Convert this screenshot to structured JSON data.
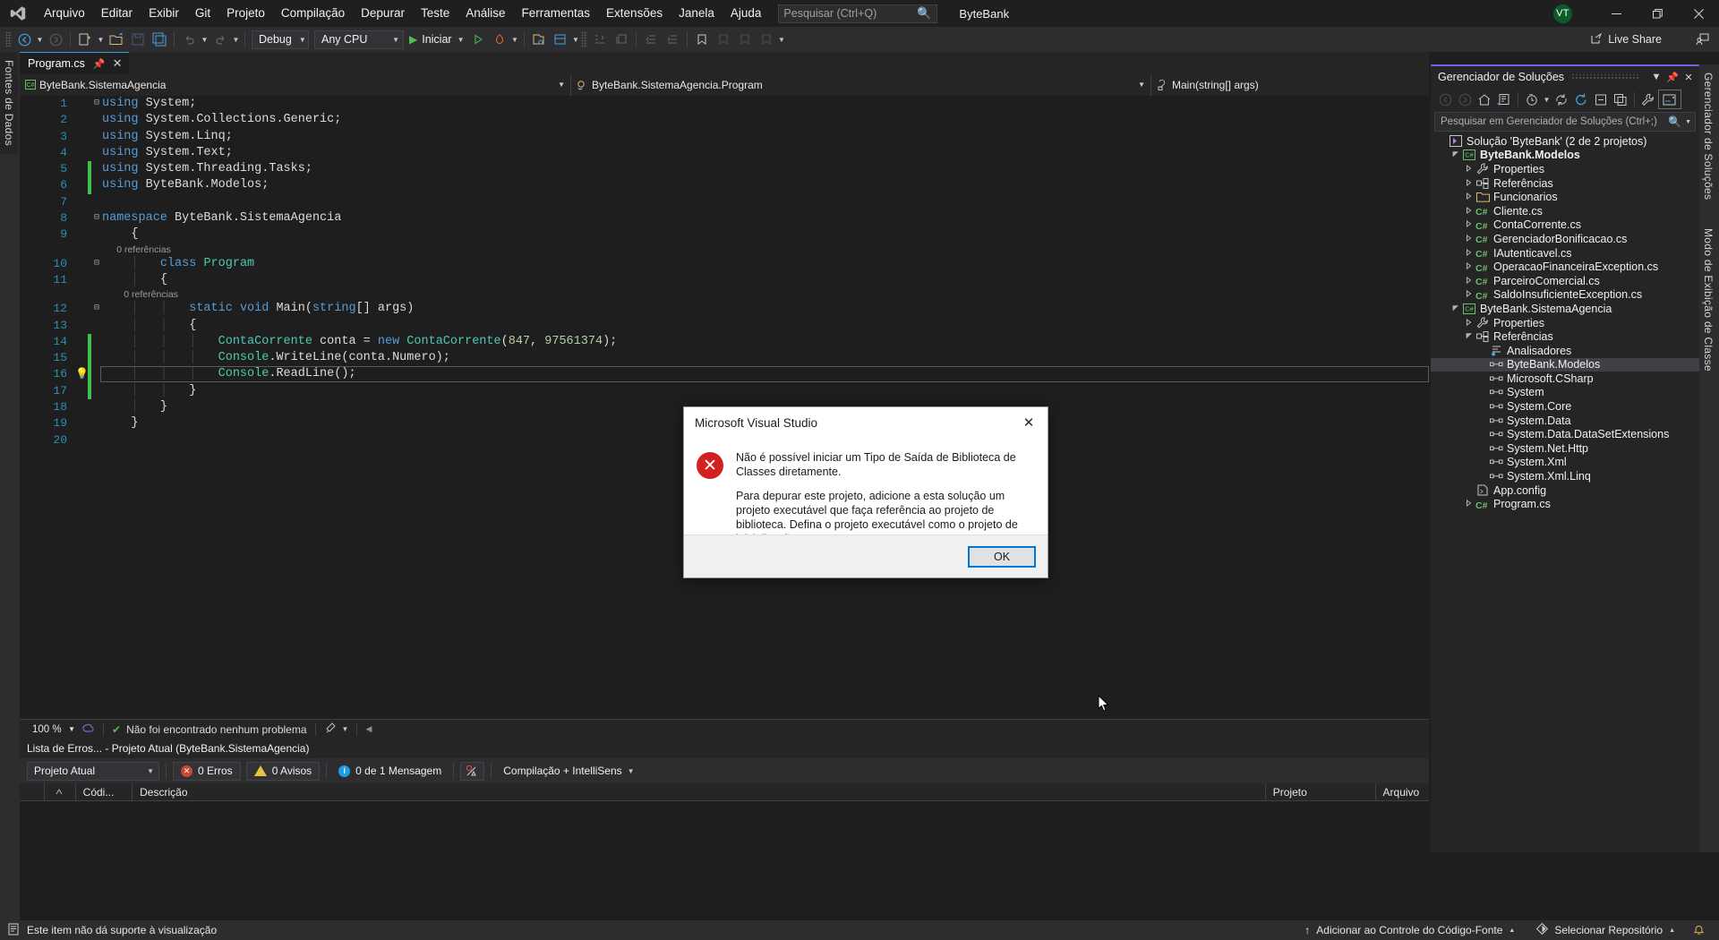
{
  "titlebar": {
    "logo_icon": "visual-studio-logo-icon",
    "menu": [
      "Arquivo",
      "Editar",
      "Exibir",
      "Git",
      "Projeto",
      "Compilação",
      "Depurar",
      "Teste",
      "Análise",
      "Ferramentas",
      "Extensões",
      "Janela",
      "Ajuda"
    ],
    "search_placeholder": "Pesquisar (Ctrl+Q)",
    "search_value": "",
    "search_icon": "search-icon",
    "solution_name": "ByteBank",
    "avatar_initials": "VT",
    "minimize_icon": "minimize-icon",
    "restore_icon": "restore-icon",
    "close_icon": "close-icon"
  },
  "toolbar": {
    "nav_back_icon": "navigate-back-icon",
    "nav_forward_icon": "navigate-forward-icon",
    "new_project_icon": "new-project-icon",
    "open_icon": "open-folder-icon",
    "save_icon": "save-icon",
    "save_all_icon": "save-all-icon",
    "undo_icon": "undo-icon",
    "redo_icon": "redo-icon",
    "config_value": "Debug",
    "platform_value": "Any CPU",
    "start_label": "Iniciar",
    "start_icon": "play-triangle-icon",
    "start_no_debug_icon": "play-outline-icon",
    "hotreload_icon": "hot-reload-icon",
    "preview_icon": "preview-changes-icon",
    "live_share_label": "Live Share",
    "live_share_icon": "live-share-icon",
    "live_share_user_icon": "live-share-user-icon"
  },
  "left_dock": {
    "tab_label": "Fontes de Dados"
  },
  "right_dock": {
    "tabs": [
      "Gerenciador de Soluções",
      "Modo de Exibição de Classe"
    ]
  },
  "editor": {
    "tab_label": "Program.cs",
    "tab_pin_icon": "pin-icon",
    "tab_close_icon": "close-icon",
    "nav_project": "ByteBank.SistemaAgencia",
    "nav_project_icon": "csharp-project-icon",
    "nav_type": "ByteBank.SistemaAgencia.Program",
    "nav_type_icon": "class-icon",
    "nav_member": "Main(string[] args)",
    "nav_member_icon": "method-icon",
    "current_line": 16,
    "lines": [
      {
        "n": 1,
        "fold": "minus",
        "change": "",
        "ref": null,
        "tokens": [
          {
            "t": "using",
            "c": "kw"
          },
          {
            "t": " System;",
            "c": ""
          }
        ],
        "indent": 0
      },
      {
        "n": 2,
        "fold": "",
        "change": "",
        "ref": null,
        "tokens": [
          {
            "t": "using",
            "c": "kw"
          },
          {
            "t": " System.Collections.Generic;",
            "c": ""
          }
        ],
        "indent": 0
      },
      {
        "n": 3,
        "fold": "",
        "change": "",
        "ref": null,
        "tokens": [
          {
            "t": "using",
            "c": "kw"
          },
          {
            "t": " System.Linq;",
            "c": ""
          }
        ],
        "indent": 0
      },
      {
        "n": 4,
        "fold": "",
        "change": "",
        "ref": null,
        "tokens": [
          {
            "t": "using",
            "c": "kw"
          },
          {
            "t": " System.Text;",
            "c": ""
          }
        ],
        "indent": 0
      },
      {
        "n": 5,
        "fold": "",
        "change": "green",
        "ref": null,
        "tokens": [
          {
            "t": "using",
            "c": "kw"
          },
          {
            "t": " System.Threading.Tasks;",
            "c": ""
          }
        ],
        "indent": 0
      },
      {
        "n": 6,
        "fold": "",
        "change": "green",
        "ref": null,
        "tokens": [
          {
            "t": "using",
            "c": "kw"
          },
          {
            "t": " ByteBank.Modelos;",
            "c": ""
          }
        ],
        "indent": 0
      },
      {
        "n": 7,
        "fold": "",
        "change": "",
        "ref": null,
        "tokens": [],
        "indent": 0
      },
      {
        "n": 8,
        "fold": "minus",
        "change": "",
        "ref": null,
        "tokens": [
          {
            "t": "namespace",
            "c": "kw"
          },
          {
            "t": " ByteBank.SistemaAgencia",
            "c": ""
          }
        ],
        "indent": 0
      },
      {
        "n": 9,
        "fold": "",
        "change": "",
        "ref": null,
        "tokens": [
          {
            "t": "{",
            "c": ""
          }
        ],
        "indent": 1
      },
      {
        "n": 10,
        "fold": "minus",
        "change": "",
        "ref": "0 referências",
        "tokens": [
          {
            "t": "class",
            "c": "kw"
          },
          {
            "t": " ",
            "c": ""
          },
          {
            "t": "Program",
            "c": "typ"
          }
        ],
        "indent": 2
      },
      {
        "n": 11,
        "fold": "",
        "change": "",
        "ref": null,
        "tokens": [
          {
            "t": "{",
            "c": ""
          }
        ],
        "indent": 2
      },
      {
        "n": 12,
        "fold": "minus",
        "change": "",
        "ref": "0 referências",
        "tokens": [
          {
            "t": "static",
            "c": "kw"
          },
          {
            "t": " ",
            "c": ""
          },
          {
            "t": "void",
            "c": "kw"
          },
          {
            "t": " Main(",
            "c": ""
          },
          {
            "t": "string",
            "c": "kw"
          },
          {
            "t": "[] args)",
            "c": ""
          }
        ],
        "indent": 3
      },
      {
        "n": 13,
        "fold": "",
        "change": "",
        "ref": null,
        "tokens": [
          {
            "t": "{",
            "c": ""
          }
        ],
        "indent": 3
      },
      {
        "n": 14,
        "fold": "",
        "change": "green",
        "ref": null,
        "tokens": [
          {
            "t": "ContaCorrente",
            "c": "typ"
          },
          {
            "t": " conta = ",
            "c": ""
          },
          {
            "t": "new",
            "c": "kw"
          },
          {
            "t": " ",
            "c": ""
          },
          {
            "t": "ContaCorrente",
            "c": "typ"
          },
          {
            "t": "(",
            "c": ""
          },
          {
            "t": "847",
            "c": "num"
          },
          {
            "t": ", ",
            "c": ""
          },
          {
            "t": "97561374",
            "c": "num"
          },
          {
            "t": ");",
            "c": ""
          }
        ],
        "indent": 4
      },
      {
        "n": 15,
        "fold": "",
        "change": "green",
        "ref": null,
        "tokens": [
          {
            "t": "Console",
            "c": "typ"
          },
          {
            "t": ".WriteLine(conta.Numero);",
            "c": ""
          }
        ],
        "indent": 4
      },
      {
        "n": 16,
        "fold": "",
        "change": "green",
        "ref": null,
        "glyph": "lightbulb",
        "tokens": [
          {
            "t": "Console",
            "c": "typ"
          },
          {
            "t": ".ReadLine();",
            "c": ""
          }
        ],
        "indent": 4
      },
      {
        "n": 17,
        "fold": "",
        "change": "green",
        "ref": null,
        "tokens": [
          {
            "t": "}",
            "c": ""
          }
        ],
        "indent": 3
      },
      {
        "n": 18,
        "fold": "",
        "change": "",
        "ref": null,
        "tokens": [
          {
            "t": "}",
            "c": ""
          }
        ],
        "indent": 2
      },
      {
        "n": 19,
        "fold": "",
        "change": "",
        "ref": null,
        "tokens": [
          {
            "t": "}",
            "c": ""
          }
        ],
        "indent": 1
      },
      {
        "n": 20,
        "fold": "",
        "change": "",
        "ref": null,
        "tokens": [],
        "indent": 0
      }
    ]
  },
  "editor_status": {
    "zoom": "100 %",
    "zoom_caret_icon": "chevron-down-icon",
    "intellicode_icon": "intellicode-icon",
    "health_text": "Não foi encontrado nenhum problema",
    "health_icon": "check-circle-icon",
    "broom_icon": "code-cleanup-icon",
    "collapse_icon": "collapse-left-icon"
  },
  "error_list": {
    "title": "Lista de Erros... - Projeto Atual (ByteBank.SistemaAgencia)",
    "scope_value": "Projeto Atual",
    "errors_label": "0 Erros",
    "warnings_label": "0 Avisos",
    "messages_label": "0 de 1 Mensagem",
    "filter_icon": "error-filter-icon",
    "build_filter": "Compilação + IntelliSens",
    "columns": [
      "",
      "Códi...",
      "Descrição",
      "Projeto",
      "Arquivo"
    ]
  },
  "solution_explorer": {
    "title": "Gerenciador de Soluções",
    "dropdown_icon": "chevron-down-icon",
    "pin_icon": "pin-icon",
    "close_icon": "close-icon",
    "toolbar_icons": [
      "back-icon",
      "forward-icon",
      "home-icon",
      "solution-views-icon",
      "pending-changes-icon",
      "refresh-icon",
      "sync-icon",
      "collapse-all-icon",
      "show-all-files-icon",
      "properties-wrench-icon",
      "preview-selected-icon"
    ],
    "search_placeholder": "Pesquisar em Gerenciador de Soluções (Ctrl+;)",
    "search_icon": "search-icon",
    "search_caret_icon": "chevron-down-icon",
    "tree": [
      {
        "label": "Solução 'ByteBank' (2 de 2 projetos)",
        "indent": 0,
        "exp": "",
        "icon": "solution-icon",
        "bold": false,
        "sel": false
      },
      {
        "label": "ByteBank.Modelos",
        "indent": 1,
        "exp": "open",
        "icon": "csharp-project-icon",
        "bold": true,
        "sel": false
      },
      {
        "label": "Properties",
        "indent": 2,
        "exp": "closed",
        "icon": "wrench-icon",
        "bold": false,
        "sel": false
      },
      {
        "label": "Referências",
        "indent": 2,
        "exp": "closed",
        "icon": "references-icon",
        "bold": false,
        "sel": false
      },
      {
        "label": "Funcionarios",
        "indent": 2,
        "exp": "closed",
        "icon": "folder-icon",
        "bold": false,
        "sel": false
      },
      {
        "label": "Cliente.cs",
        "indent": 2,
        "exp": "closed",
        "icon": "csharp-file-icon",
        "bold": false,
        "sel": false
      },
      {
        "label": "ContaCorrente.cs",
        "indent": 2,
        "exp": "closed",
        "icon": "csharp-file-icon",
        "bold": false,
        "sel": false
      },
      {
        "label": "GerenciadorBonificacao.cs",
        "indent": 2,
        "exp": "closed",
        "icon": "csharp-file-icon",
        "bold": false,
        "sel": false
      },
      {
        "label": "IAutenticavel.cs",
        "indent": 2,
        "exp": "closed",
        "icon": "csharp-file-icon",
        "bold": false,
        "sel": false
      },
      {
        "label": "OperacaoFinanceiraException.cs",
        "indent": 2,
        "exp": "closed",
        "icon": "csharp-file-icon",
        "bold": false,
        "sel": false
      },
      {
        "label": "ParceiroComercial.cs",
        "indent": 2,
        "exp": "closed",
        "icon": "csharp-file-icon",
        "bold": false,
        "sel": false
      },
      {
        "label": "SaldoInsuficienteException.cs",
        "indent": 2,
        "exp": "closed",
        "icon": "csharp-file-icon",
        "bold": false,
        "sel": false
      },
      {
        "label": "ByteBank.SistemaAgencia",
        "indent": 1,
        "exp": "open",
        "icon": "csharp-project-icon",
        "bold": false,
        "sel": false
      },
      {
        "label": "Properties",
        "indent": 2,
        "exp": "closed",
        "icon": "wrench-icon",
        "bold": false,
        "sel": false
      },
      {
        "label": "Referências",
        "indent": 2,
        "exp": "open",
        "icon": "references-icon",
        "bold": false,
        "sel": false
      },
      {
        "label": "Analisadores",
        "indent": 3,
        "exp": "",
        "icon": "analyzers-icon",
        "bold": false,
        "sel": false
      },
      {
        "label": "ByteBank.Modelos",
        "indent": 3,
        "exp": "",
        "icon": "assembly-icon",
        "bold": false,
        "sel": true
      },
      {
        "label": "Microsoft.CSharp",
        "indent": 3,
        "exp": "",
        "icon": "assembly-icon",
        "bold": false,
        "sel": false
      },
      {
        "label": "System",
        "indent": 3,
        "exp": "",
        "icon": "assembly-icon",
        "bold": false,
        "sel": false
      },
      {
        "label": "System.Core",
        "indent": 3,
        "exp": "",
        "icon": "assembly-icon",
        "bold": false,
        "sel": false
      },
      {
        "label": "System.Data",
        "indent": 3,
        "exp": "",
        "icon": "assembly-icon",
        "bold": false,
        "sel": false
      },
      {
        "label": "System.Data.DataSetExtensions",
        "indent": 3,
        "exp": "",
        "icon": "assembly-icon",
        "bold": false,
        "sel": false
      },
      {
        "label": "System.Net.Http",
        "indent": 3,
        "exp": "",
        "icon": "assembly-icon",
        "bold": false,
        "sel": false
      },
      {
        "label": "System.Xml",
        "indent": 3,
        "exp": "",
        "icon": "assembly-icon",
        "bold": false,
        "sel": false
      },
      {
        "label": "System.Xml.Linq",
        "indent": 3,
        "exp": "",
        "icon": "assembly-icon",
        "bold": false,
        "sel": false
      },
      {
        "label": "App.config",
        "indent": 2,
        "exp": "",
        "icon": "config-file-icon",
        "bold": false,
        "sel": false
      },
      {
        "label": "Program.cs",
        "indent": 2,
        "exp": "closed",
        "icon": "csharp-file-icon",
        "bold": false,
        "sel": false
      }
    ]
  },
  "dialog": {
    "title": "Microsoft Visual Studio",
    "close_icon": "close-icon",
    "error_icon": "error-x-icon",
    "paragraph1": "Não é possível iniciar um Tipo de Saída de Biblioteca de Classes diretamente.",
    "paragraph2": "Para depurar este projeto, adicione a esta solução um projeto executável que faça referência ao projeto de biblioteca. Defina o projeto executável como o projeto de inicialização.",
    "ok_label": "OK"
  },
  "statusbar": {
    "message": "Este item não dá suporte à visualização",
    "message_icon": "preview-item-icon",
    "source_control_label": "Adicionar ao Controle do Código-Fonte",
    "source_control_icon": "arrow-up-icon",
    "repo_label": "Selecionar Repositório",
    "repo_icon": "repository-icon",
    "notification_icon": "bell-icon",
    "caret_icon": "chevron-up-icon"
  }
}
